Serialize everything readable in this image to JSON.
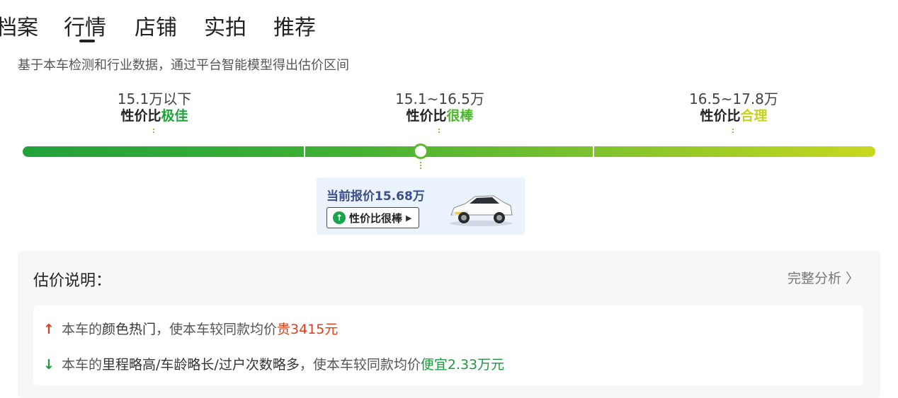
{
  "tabs": [
    "档案",
    "行情",
    "店铺",
    "实拍",
    "推荐"
  ],
  "subtitle": "基于本车检测和行业数据，通过平台智能模型得出估价区间",
  "tiers": [
    {
      "range": "15.1万以下",
      "prefix": "性价比",
      "rating": "极佳"
    },
    {
      "range": "15.1~16.5万",
      "prefix": "性价比",
      "rating": "很棒"
    },
    {
      "range": "16.5~17.8万",
      "prefix": "性价比",
      "rating": "合理"
    }
  ],
  "current": {
    "price_text": "当前报价15.68万",
    "badge": "性价比很棒",
    "price_value_wan": 15.68
  },
  "explain": {
    "title": "估价说明：",
    "full_link": "完整分析 〉",
    "rows": [
      {
        "direction": "up",
        "prefix": "本车的",
        "factor": "颜色热门",
        "middle": "，使本车较同款均价",
        "amount": "贵3415元"
      },
      {
        "direction": "down",
        "prefix": "本车的",
        "factor": "里程略高/车龄略长/过户次数略多",
        "middle": "，使本车较同款均价",
        "amount": "便宜2.33万元"
      }
    ]
  },
  "colors": {
    "great": "#1ea43a",
    "good": "#4bb82b",
    "ok": "#c6d21a",
    "up": "#e03b14",
    "down": "#1a9a3c"
  }
}
